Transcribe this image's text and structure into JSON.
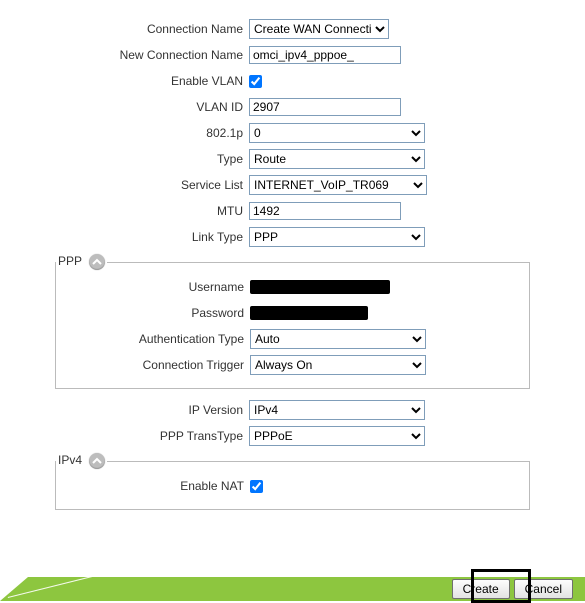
{
  "connection": {
    "name_label": "Connection Name",
    "name_value": "Create WAN Connection",
    "new_name_label": "New Connection Name",
    "new_name_value": "omci_ipv4_pppoe_",
    "enable_vlan_label": "Enable VLAN",
    "enable_vlan_checked": true,
    "vlan_id_label": "VLAN ID",
    "vlan_id_value": "2907",
    "p8021_label": "802.1p",
    "p8021_value": "0",
    "type_label": "Type",
    "type_value": "Route",
    "service_list_label": "Service List",
    "service_list_value": "INTERNET_VoIP_TR069",
    "mtu_label": "MTU",
    "mtu_value": "1492",
    "link_type_label": "Link Type",
    "link_type_value": "PPP"
  },
  "ppp": {
    "legend": "PPP",
    "username_label": "Username",
    "password_label": "Password",
    "auth_type_label": "Authentication Type",
    "auth_type_value": "Auto",
    "conn_trigger_label": "Connection Trigger",
    "conn_trigger_value": "Always On"
  },
  "ip": {
    "version_label": "IP Version",
    "version_value": "IPv4",
    "ppp_transtype_label": "PPP TransType",
    "ppp_transtype_value": "PPPoE"
  },
  "ipv4": {
    "legend": "IPv4",
    "enable_nat_label": "Enable NAT",
    "enable_nat_checked": true
  },
  "footer": {
    "create_label": "Create",
    "cancel_label": "Cancel"
  }
}
